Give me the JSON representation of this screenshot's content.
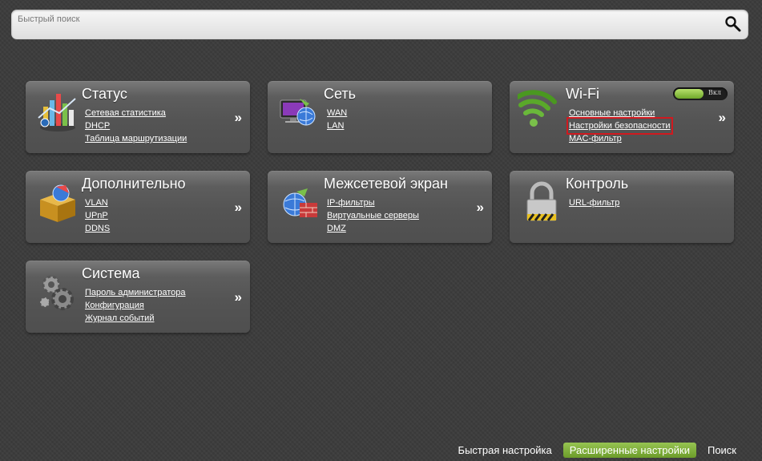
{
  "search": {
    "placeholder": "Быстрый поиск",
    "button_icon": "search-icon"
  },
  "tiles": {
    "status": {
      "title": "Статус",
      "icon": "bar-chart-icon",
      "links": [
        "Сетевая статистика",
        "DHCP",
        "Таблица маршрутизации"
      ]
    },
    "network": {
      "title": "Сеть",
      "icon": "network-globe-icon",
      "links": [
        "WAN",
        "LAN"
      ]
    },
    "wifi": {
      "title": "Wi-Fi",
      "icon": "wifi-signal-icon",
      "toggle_label": "Вкл",
      "toggle_state": "on",
      "links": [
        "Основные настройки",
        "Настройки безопасности",
        "MAC-фильтр"
      ],
      "highlighted_link": "Настройки безопасности"
    },
    "advanced": {
      "title": "Дополнительно",
      "icon": "box-icon",
      "links": [
        "VLAN",
        "UPnP",
        "DDNS"
      ]
    },
    "firewall": {
      "title": "Межсетевой экран",
      "icon": "firewall-icon",
      "links": [
        "IP-фильтры",
        "Виртуальные серверы",
        "DMZ"
      ]
    },
    "control": {
      "title": "Контроль",
      "icon": "padlock-icon",
      "links": [
        "URL-фильтр"
      ]
    },
    "system": {
      "title": "Система",
      "icon": "gears-icon",
      "links": [
        "Пароль администратора",
        "Конфигурация",
        "Журнал событий"
      ]
    }
  },
  "arrow_glyph": "»",
  "bottom_nav": {
    "quick_setup": "Быстрая настройка",
    "advanced_settings": "Расширенные настройки",
    "search": "Поиск",
    "active": "advanced_settings"
  },
  "colors": {
    "background": "#3b3b3b",
    "accent_green": "#7fb03a",
    "highlight_red": "#d0191f"
  }
}
